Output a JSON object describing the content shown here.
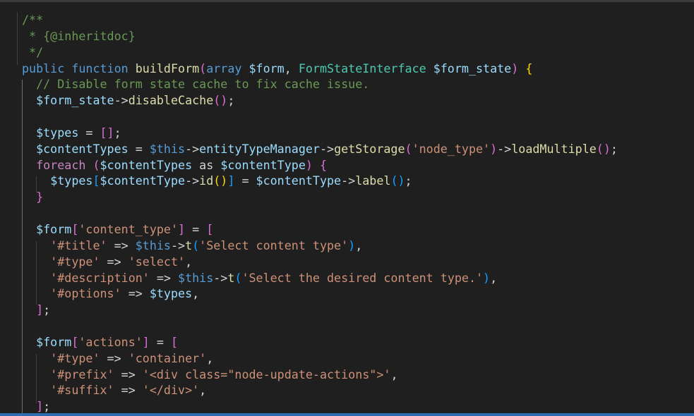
{
  "editor": {
    "language": "php",
    "theme_colors": {
      "background": "#1f1f1f",
      "comment": "#6a9955",
      "keyword": "#569cd6",
      "control": "#c586c0",
      "function": "#dcdcaa",
      "type": "#4ec9b0",
      "variable": "#9cdcfe",
      "string": "#ce9178",
      "bracket_1": "#ffd700",
      "bracket_2": "#da70d6",
      "bracket_3": "#179fff",
      "status_bar": "#2f6db3"
    },
    "lines": [
      [
        [
          "cm",
          "/**"
        ]
      ],
      [
        [
          "cm",
          " * {@inheritdoc}"
        ]
      ],
      [
        [
          "cm",
          " */"
        ]
      ],
      [
        [
          "kw",
          "public"
        ],
        [
          "op",
          " "
        ],
        [
          "kw",
          "function"
        ],
        [
          "op",
          " "
        ],
        [
          "fn",
          "buildForm"
        ],
        [
          "b2",
          "("
        ],
        [
          "kw",
          "array"
        ],
        [
          "op",
          " "
        ],
        [
          "vr",
          "$form"
        ],
        [
          "op",
          ", "
        ],
        [
          "ty",
          "FormStateInterface"
        ],
        [
          "op",
          " "
        ],
        [
          "vr",
          "$form_state"
        ],
        [
          "b2",
          ")"
        ],
        [
          "op",
          " "
        ],
        [
          "b1",
          "{"
        ]
      ],
      [
        [
          "cm",
          "  // Disable form state cache to fix cache issue."
        ]
      ],
      [
        [
          "op",
          "  "
        ],
        [
          "vr",
          "$form_state"
        ],
        [
          "op",
          "->"
        ],
        [
          "fn",
          "disableCache"
        ],
        [
          "b2",
          "()"
        ],
        [
          "op",
          ";"
        ]
      ],
      [],
      [
        [
          "op",
          "  "
        ],
        [
          "vr",
          "$types"
        ],
        [
          "op",
          " = "
        ],
        [
          "b2",
          "[]"
        ],
        [
          "op",
          ";"
        ]
      ],
      [
        [
          "op",
          "  "
        ],
        [
          "vr",
          "$contentTypes"
        ],
        [
          "op",
          " = "
        ],
        [
          "kw",
          "$this"
        ],
        [
          "op",
          "->"
        ],
        [
          "vr",
          "entityTypeManager"
        ],
        [
          "op",
          "->"
        ],
        [
          "fn",
          "getStorage"
        ],
        [
          "b2",
          "("
        ],
        [
          "st",
          "'node_type'"
        ],
        [
          "b2",
          ")"
        ],
        [
          "op",
          "->"
        ],
        [
          "fn",
          "loadMultiple"
        ],
        [
          "b2",
          "()"
        ],
        [
          "op",
          ";"
        ]
      ],
      [
        [
          "op",
          "  "
        ],
        [
          "kc",
          "foreach"
        ],
        [
          "op",
          " "
        ],
        [
          "b2",
          "("
        ],
        [
          "vr",
          "$contentTypes"
        ],
        [
          "op",
          " as "
        ],
        [
          "vr",
          "$contentType"
        ],
        [
          "b2",
          ")"
        ],
        [
          "op",
          " "
        ],
        [
          "b2",
          "{"
        ]
      ],
      [
        [
          "op",
          "    "
        ],
        [
          "vr",
          "$types"
        ],
        [
          "b3",
          "["
        ],
        [
          "vr",
          "$contentType"
        ],
        [
          "op",
          "->"
        ],
        [
          "fn",
          "id"
        ],
        [
          "b1",
          "()"
        ],
        [
          "b3",
          "]"
        ],
        [
          "op",
          " = "
        ],
        [
          "vr",
          "$contentType"
        ],
        [
          "op",
          "->"
        ],
        [
          "fn",
          "label"
        ],
        [
          "b3",
          "()"
        ],
        [
          "op",
          ";"
        ]
      ],
      [
        [
          "op",
          "  "
        ],
        [
          "b2",
          "}"
        ]
      ],
      [],
      [
        [
          "op",
          "  "
        ],
        [
          "vr",
          "$form"
        ],
        [
          "b2",
          "["
        ],
        [
          "st",
          "'content_type'"
        ],
        [
          "b2",
          "]"
        ],
        [
          "op",
          " = "
        ],
        [
          "b2",
          "["
        ]
      ],
      [
        [
          "op",
          "    "
        ],
        [
          "st",
          "'#title'"
        ],
        [
          "op",
          " => "
        ],
        [
          "kw",
          "$this"
        ],
        [
          "op",
          "->"
        ],
        [
          "fn",
          "t"
        ],
        [
          "b3",
          "("
        ],
        [
          "st",
          "'Select content type'"
        ],
        [
          "b3",
          ")"
        ],
        [
          "op",
          ","
        ]
      ],
      [
        [
          "op",
          "    "
        ],
        [
          "st",
          "'#type'"
        ],
        [
          "op",
          " => "
        ],
        [
          "st",
          "'select'"
        ],
        [
          "op",
          ","
        ]
      ],
      [
        [
          "op",
          "    "
        ],
        [
          "st",
          "'#description'"
        ],
        [
          "op",
          " => "
        ],
        [
          "kw",
          "$this"
        ],
        [
          "op",
          "->"
        ],
        [
          "fn",
          "t"
        ],
        [
          "b3",
          "("
        ],
        [
          "st",
          "'Select the desired content type.'"
        ],
        [
          "b3",
          ")"
        ],
        [
          "op",
          ","
        ]
      ],
      [
        [
          "op",
          "    "
        ],
        [
          "st",
          "'#options'"
        ],
        [
          "op",
          " => "
        ],
        [
          "vr",
          "$types"
        ],
        [
          "op",
          ","
        ]
      ],
      [
        [
          "op",
          "  "
        ],
        [
          "b2",
          "]"
        ],
        [
          "op",
          ";"
        ]
      ],
      [],
      [
        [
          "op",
          "  "
        ],
        [
          "vr",
          "$form"
        ],
        [
          "b2",
          "["
        ],
        [
          "st",
          "'actions'"
        ],
        [
          "b2",
          "]"
        ],
        [
          "op",
          " = "
        ],
        [
          "b2",
          "["
        ]
      ],
      [
        [
          "op",
          "    "
        ],
        [
          "st",
          "'#type'"
        ],
        [
          "op",
          " => "
        ],
        [
          "st",
          "'container'"
        ],
        [
          "op",
          ","
        ]
      ],
      [
        [
          "op",
          "    "
        ],
        [
          "st",
          "'#prefix'"
        ],
        [
          "op",
          " => "
        ],
        [
          "st",
          "'<div class=\"node-update-actions\">'"
        ],
        [
          "op",
          ","
        ]
      ],
      [
        [
          "op",
          "    "
        ],
        [
          "st",
          "'#suffix'"
        ],
        [
          "op",
          " => "
        ],
        [
          "st",
          "'</div>'"
        ],
        [
          "op",
          ","
        ]
      ],
      [
        [
          "op",
          "  "
        ],
        [
          "b2",
          "]"
        ],
        [
          "op",
          ";"
        ]
      ]
    ]
  }
}
